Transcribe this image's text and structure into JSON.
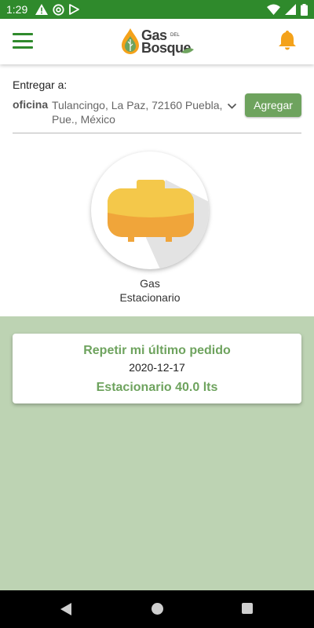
{
  "status_bar": {
    "time": "1:29",
    "left_icons": [
      "warning-icon",
      "at-sign-icon",
      "play-store-icon"
    ],
    "right_icons": [
      "wifi-icon",
      "signal-icon",
      "battery-icon"
    ]
  },
  "app_bar": {
    "logo_line1": "Gas",
    "logo_small": "DEL",
    "logo_line2": "Bosque",
    "menu_icon": "hamburger-menu-icon",
    "notification_icon": "bell-icon"
  },
  "delivery": {
    "label": "Entregar a:",
    "address_kind": "oficina",
    "address": "Tulancingo, La Paz, 72160 Puebla, Pue., México",
    "add_button": "Agregar"
  },
  "product": {
    "label_line1": "Gas",
    "label_line2": "Estacionario",
    "icon": "stationary-gas-tank-icon"
  },
  "last_order": {
    "title": "Repetir mi último pedido",
    "date": "2020-12-17",
    "product": "Estacionario 40.0 lts"
  },
  "colors": {
    "brand_green": "#2f8a2c",
    "accent_green": "#6ea35e",
    "panel_green": "#bdd3b3",
    "tank_yellow": "#f4c84a",
    "tank_orange": "#f0a53a",
    "bell_orange": "#f4a21a"
  }
}
